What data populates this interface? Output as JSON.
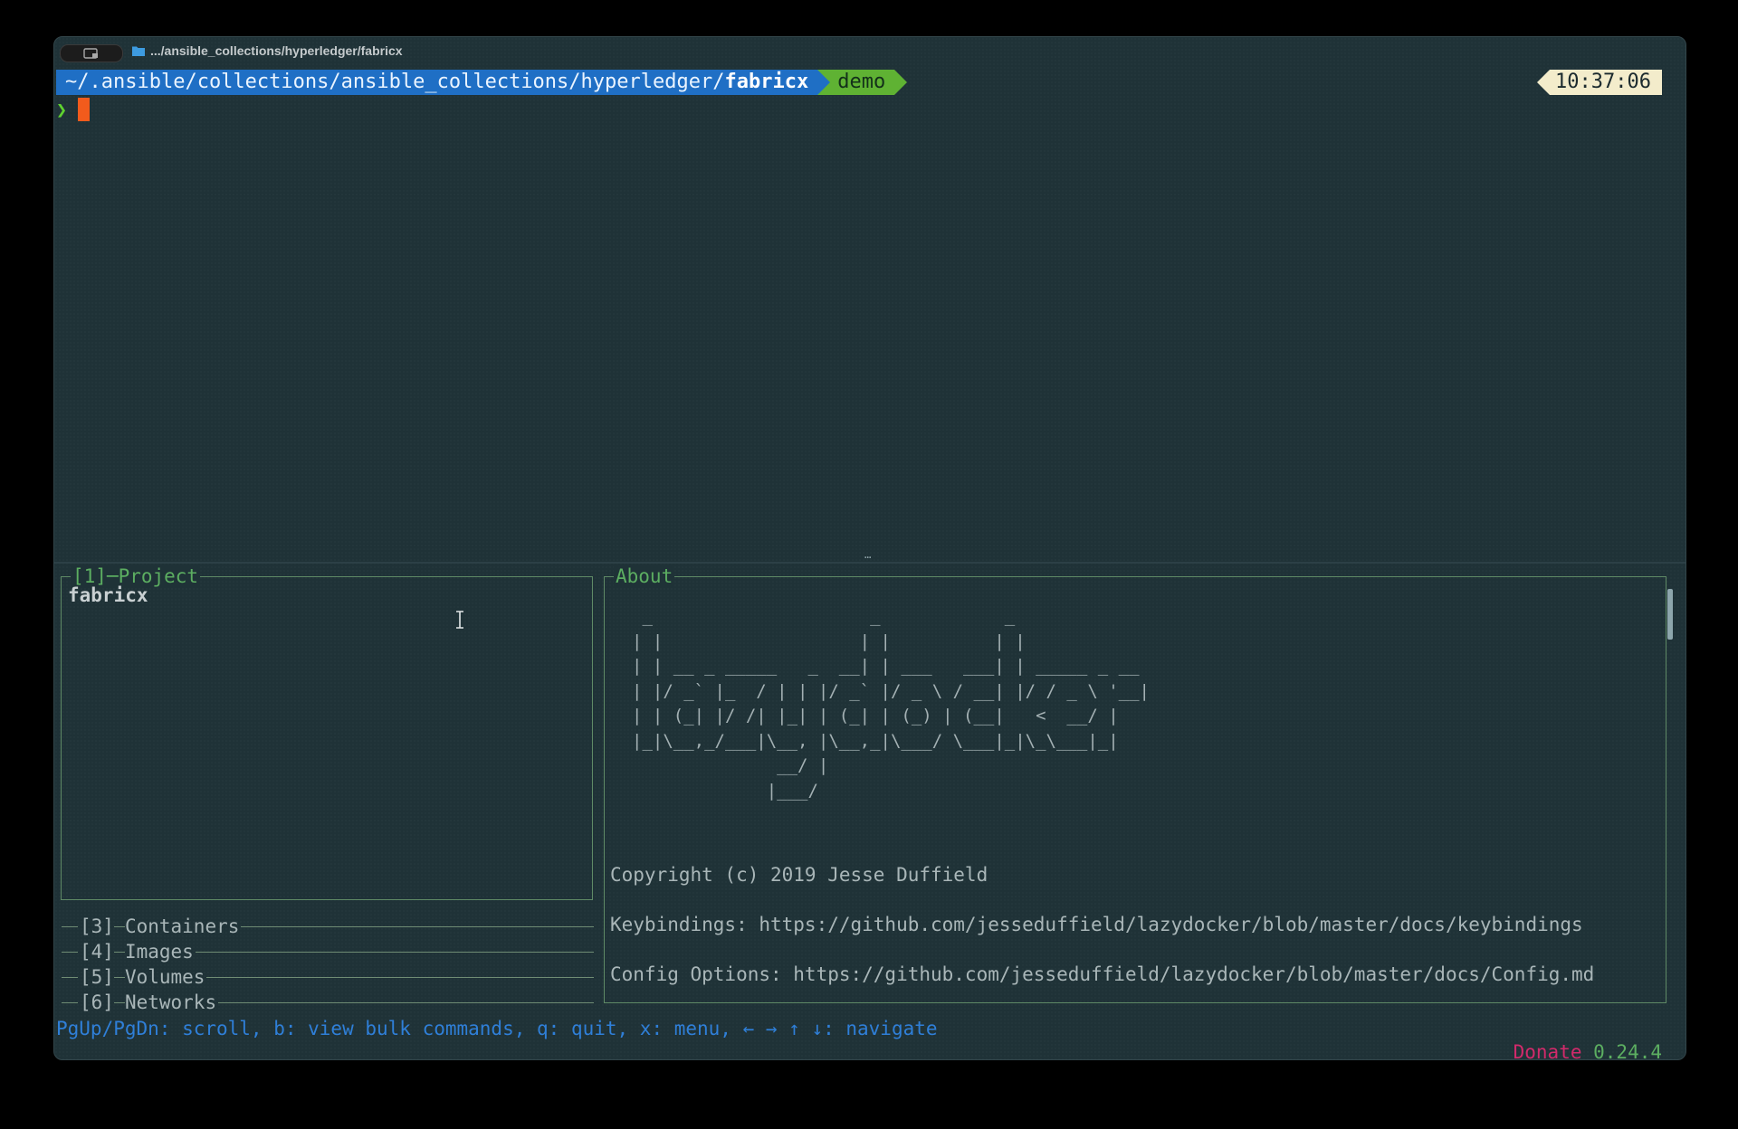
{
  "window": {
    "tab_title": ".../ansible_collections/hyperledger/fabricx"
  },
  "prompt": {
    "path_prefix": "~/.ansible/collections/ansible_collections/hyperledger/",
    "path_current": "fabricx",
    "git_branch": "demo",
    "time": "10:37:06",
    "symbol": "❯"
  },
  "lazydocker": {
    "project_panel": {
      "title": "[1]─Project",
      "project_name": "fabricx"
    },
    "collapsed_panels": [
      {
        "number": "[3]",
        "label": "Containers"
      },
      {
        "number": "[4]",
        "label": "Images"
      },
      {
        "number": "[5]",
        "label": "Volumes"
      },
      {
        "number": "[6]",
        "label": "Networks"
      }
    ],
    "about_panel": {
      "title": "About",
      "ascii_logo": " _                     _            _\n| |                   | |          | |\n| | __ _ _____   _  __| | ___   ___| | _____ _ __\n| |/ _` |_  / | | |/ _` |/ _ \\ / __| |/ / _ \\ '__|\n| | (_| |/ /| |_| | (_| | (_) | (__|   <  __/ |\n|_|\\__,_/___|\\__, |\\__,_|\\___/ \\___|_|\\_\\___|_|\n              __/ |\n             |___/",
      "copyright": "Copyright (c) 2019 Jesse Duffield",
      "keybindings": "Keybindings: https://github.com/jesseduffield/lazydocker/blob/master/docs/keybindings",
      "config": "Config Options: https://github.com/jesseduffield/lazydocker/blob/master/docs/Config.md"
    },
    "status_bar": {
      "help": "PgUp/PgDn: scroll, b: view bulk commands, q: quit, x: menu, ← → ↑ ↓: navigate",
      "donate": "Donate",
      "version": "0.24.4"
    }
  },
  "colors": {
    "background": "#1f3237",
    "path_segment": "#1f6fc5",
    "git_segment": "#5fb233",
    "clock_segment": "#f3eccb",
    "cursor": "#f25b1c",
    "panel_title": "#5cae61",
    "status_help": "#2f7fd8",
    "donate": "#d22a6b"
  }
}
